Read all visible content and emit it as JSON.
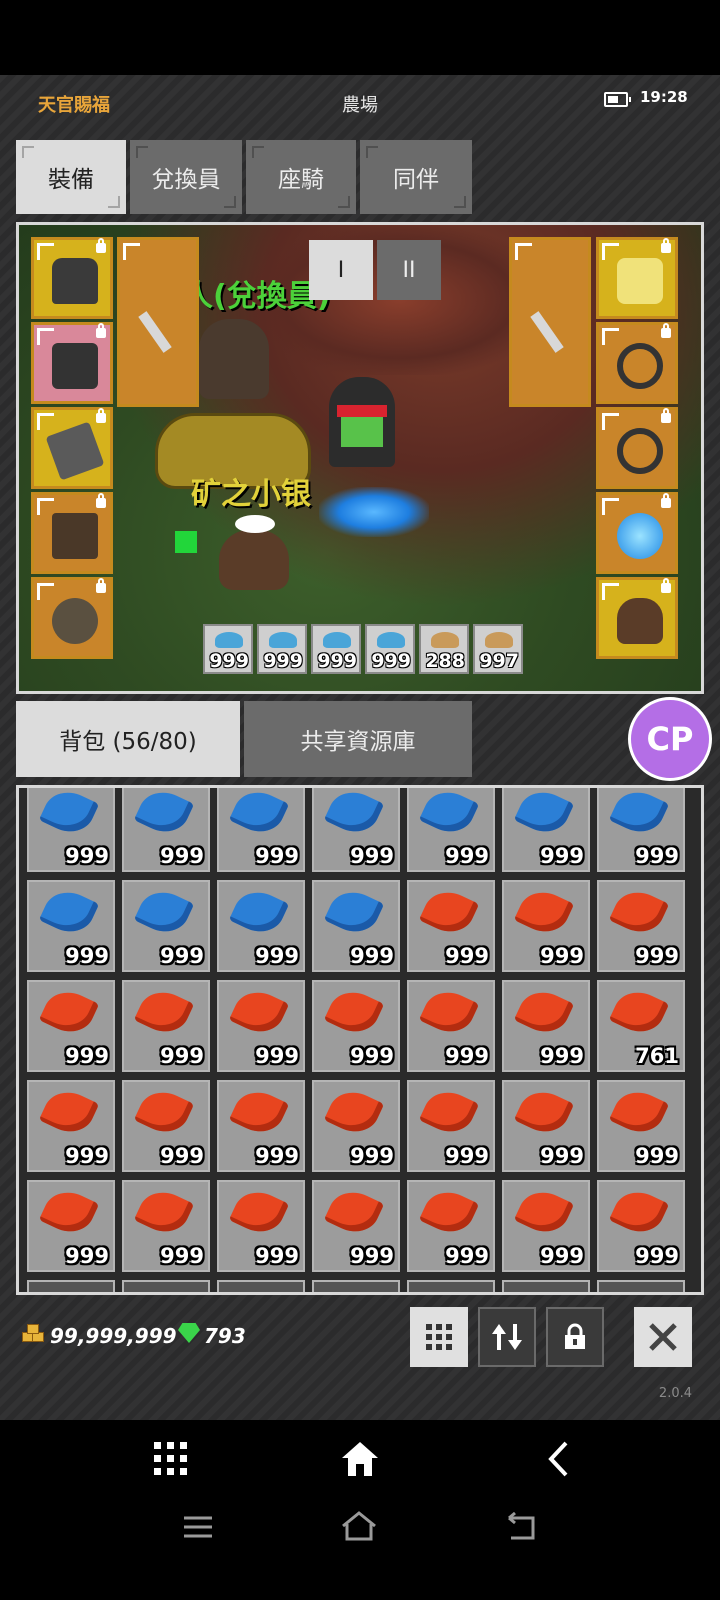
{
  "status": {
    "app_title": "天官賜福",
    "page_title": "農場",
    "time": "19:28"
  },
  "tabs": [
    "裝備",
    "兌換員",
    "座騎",
    "同伴"
  ],
  "scene": {
    "npc_label": "子商人(兌換員)",
    "pet_label": "矿之小银",
    "page_buttons": [
      "I",
      "II"
    ],
    "quick_slots": [
      "999",
      "999",
      "999",
      "999",
      "288",
      "997"
    ]
  },
  "bag_tabs": [
    "背包 (56/80)",
    "共享資源庫"
  ],
  "inventory": [
    {
      "type": "blue",
      "qty": "999"
    },
    {
      "type": "blue",
      "qty": "999"
    },
    {
      "type": "blue",
      "qty": "999"
    },
    {
      "type": "blue",
      "qty": "999"
    },
    {
      "type": "blue",
      "qty": "999"
    },
    {
      "type": "blue",
      "qty": "999"
    },
    {
      "type": "blue",
      "qty": "999"
    },
    {
      "type": "blue",
      "qty": "999"
    },
    {
      "type": "blue",
      "qty": "999"
    },
    {
      "type": "blue",
      "qty": "999"
    },
    {
      "type": "blue",
      "qty": "999"
    },
    {
      "type": "red",
      "qty": "999"
    },
    {
      "type": "red",
      "qty": "999"
    },
    {
      "type": "red",
      "qty": "999"
    },
    {
      "type": "red",
      "qty": "999"
    },
    {
      "type": "red",
      "qty": "999"
    },
    {
      "type": "red",
      "qty": "999"
    },
    {
      "type": "red",
      "qty": "999"
    },
    {
      "type": "red",
      "qty": "999"
    },
    {
      "type": "red",
      "qty": "999"
    },
    {
      "type": "red",
      "qty": "761"
    },
    {
      "type": "red",
      "qty": "999"
    },
    {
      "type": "red",
      "qty": "999"
    },
    {
      "type": "red",
      "qty": "999"
    },
    {
      "type": "red",
      "qty": "999"
    },
    {
      "type": "red",
      "qty": "999"
    },
    {
      "type": "red",
      "qty": "999"
    },
    {
      "type": "red",
      "qty": "999"
    },
    {
      "type": "red",
      "qty": "999"
    },
    {
      "type": "red",
      "qty": "999"
    },
    {
      "type": "red",
      "qty": "999"
    },
    {
      "type": "red",
      "qty": "999"
    },
    {
      "type": "red",
      "qty": "999"
    },
    {
      "type": "red",
      "qty": "999"
    },
    {
      "type": "red",
      "qty": "999"
    }
  ],
  "footer": {
    "gold": "99,999,999",
    "gems": "793",
    "version": "2.0.4"
  },
  "colors": {
    "feather_blue": "#2b7fd6",
    "feather_red": "#e8451f",
    "accent_gold": "#e8a53a"
  }
}
